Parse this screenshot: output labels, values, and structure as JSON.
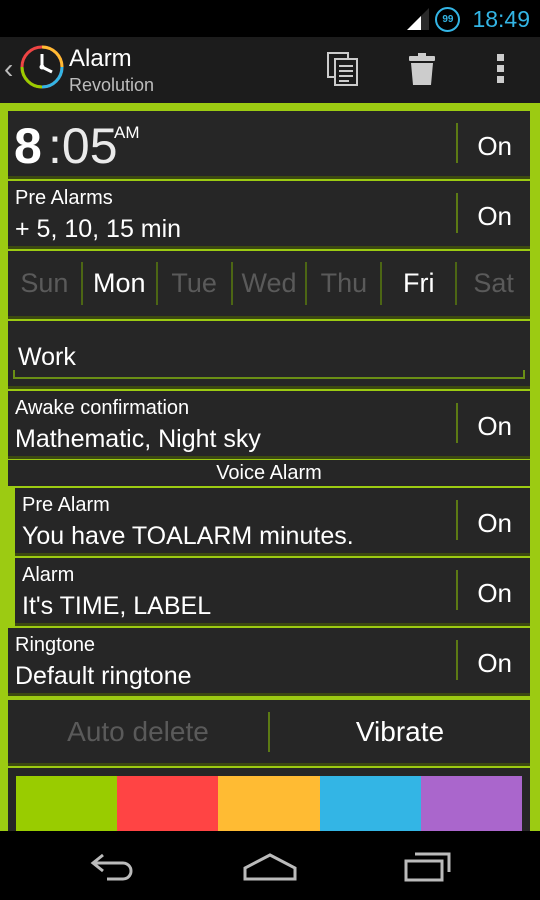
{
  "status_bar": {
    "clock": "18:49",
    "badge": "99"
  },
  "action_bar": {
    "title": "Alarm",
    "subtitle": "Revolution",
    "icons": [
      "copy-icon",
      "trash-icon",
      "overflow-menu-icon"
    ]
  },
  "alarm": {
    "hour": "8",
    "minutes": ":05",
    "ampm": "AM",
    "enabled": "On"
  },
  "pre_alarms": {
    "title": "Pre Alarms",
    "value": "+ 5, 10, 15 min",
    "toggle": "On"
  },
  "days": [
    {
      "label": "Sun",
      "active": false
    },
    {
      "label": "Mon",
      "active": true
    },
    {
      "label": "Tue",
      "active": false
    },
    {
      "label": "Wed",
      "active": false
    },
    {
      "label": "Thu",
      "active": false
    },
    {
      "label": "Fri",
      "active": true
    },
    {
      "label": "Sat",
      "active": false
    }
  ],
  "label_field": {
    "value": "Work"
  },
  "awake_confirmation": {
    "title": "Awake confirmation",
    "value": "Mathematic, Night sky",
    "toggle": "On"
  },
  "voice_alarm": {
    "header": "Voice Alarm",
    "pre_alarm": {
      "title": "Pre Alarm",
      "value": "You have TOALARM minutes.",
      "toggle": "On"
    },
    "alarm": {
      "title": "Alarm",
      "value": "It's TIME, LABEL",
      "toggle": "On"
    }
  },
  "ringtone": {
    "title": "Ringtone",
    "value": "Default ringtone",
    "toggle": "On"
  },
  "options": {
    "auto_delete": "Auto delete",
    "vibrate": "Vibrate"
  },
  "colors": {
    "accent": "#9ccb12",
    "holo_blue": "#33b5e5",
    "swatches": [
      "#99cc00",
      "#ff4444",
      "#ffbb33",
      "#33b5e5",
      "#aa66cc"
    ]
  }
}
